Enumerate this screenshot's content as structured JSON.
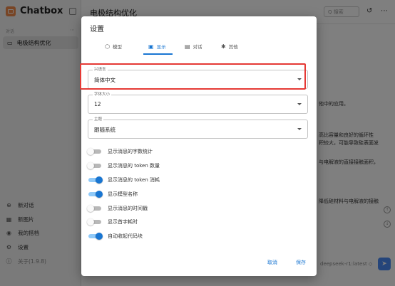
{
  "app": {
    "brand": "Chatbox",
    "conversations_header": "对话",
    "conversation_item": "电极结构优化",
    "menu": [
      {
        "icon": "⊕",
        "label": "新对话"
      },
      {
        "icon": "▦",
        "label": "新图片"
      },
      {
        "icon": "◉",
        "label": "我的搭档"
      },
      {
        "icon": "⚙",
        "label": "设置"
      },
      {
        "icon": "ⓘ",
        "label": "关于(1.9.8)"
      }
    ],
    "chat_title": "电极结构优化",
    "search_placeholder": "Q 搜索",
    "background_lines": [
      "他中的应用。",
      "高比容量和良好的循环性",
      "积较大，可能导致硅表面发",
      "与电解液的直接接触面积，",
      "降低硅材料与电解液的接触"
    ],
    "model_tag": "deepseek-r1:latest ◇"
  },
  "dialog": {
    "title": "设置",
    "tabs": [
      {
        "icon": "⬡",
        "label": "模型"
      },
      {
        "icon": "▣",
        "label": "显示"
      },
      {
        "icon": "▤",
        "label": "对话"
      },
      {
        "icon": "✱",
        "label": "其他"
      }
    ],
    "fields": [
      {
        "label": "兴语言",
        "value": "简体中文"
      },
      {
        "label": "字体大小",
        "value": "12"
      },
      {
        "label": "主题",
        "value": "跟随系统"
      }
    ],
    "toggles": [
      {
        "label": "显示消息的字数统计",
        "on": false
      },
      {
        "label": "显示消息的 token 数量",
        "on": false
      },
      {
        "label": "显示消息的 token 消耗",
        "on": true
      },
      {
        "label": "显示模型名称",
        "on": true
      },
      {
        "label": "显示消息的时间戳",
        "on": false
      },
      {
        "label": "显示首字耗时",
        "on": false
      },
      {
        "label": "自动收起代码块",
        "on": true
      }
    ],
    "cancel_label": "取消",
    "save_label": "保存"
  }
}
